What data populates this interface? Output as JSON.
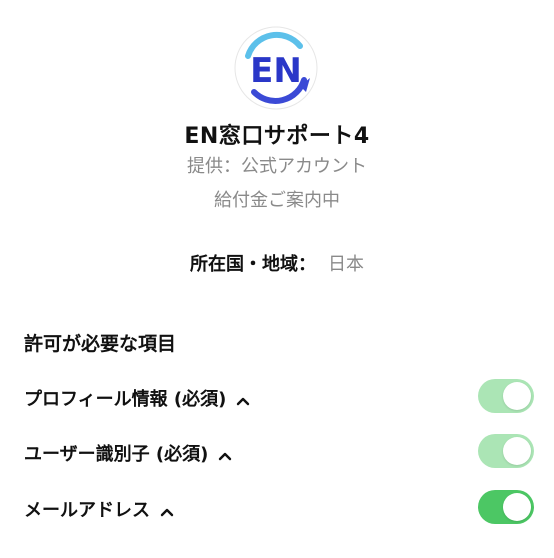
{
  "account": {
    "logo_text": "EN",
    "name": "EN窓口サポート4",
    "provider": "提供：公式アカウント",
    "description": "給付金ご案内中"
  },
  "region": {
    "label": "所在国・地域：",
    "value": "日本"
  },
  "permissions": {
    "title": "許可が必要な項目",
    "items": [
      {
        "label": "プロフィール情報 (必須)",
        "enabled": true,
        "locked": true
      },
      {
        "label": "ユーザー識別子 (必須)",
        "enabled": true,
        "locked": true
      },
      {
        "label": "メールアドレス",
        "enabled": true,
        "locked": false
      }
    ]
  },
  "colors": {
    "toggle_on": "#4cc764",
    "toggle_on_disabled": "#abe5b5",
    "secondary_text": "#8a8a8a",
    "logo_blue": "#2a37c8"
  },
  "icons": {
    "expand": "chevron-up-icon"
  }
}
